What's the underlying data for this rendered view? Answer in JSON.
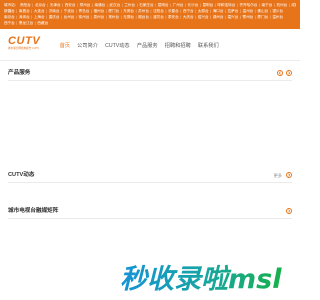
{
  "topbar": {
    "prefix": "城市站：",
    "lines": [
      [
        "贵阳台",
        "北京台",
        "天津台",
        "西安台",
        "郑州台",
        "南通台",
        "武汉台",
        "兰州台",
        "石家庄台",
        "昆明台",
        "广州台",
        "长沙台",
        "昆明台",
        "呼和浩特台",
        "齐齐哈尔台",
        "南宁台",
        "杭州台",
        "成都台",
        "合肥台"
      ],
      [
        "新疆台",
        "南昌台",
        "大连台",
        "济南台",
        "宁波台",
        "青岛台",
        "福州台",
        "厦门台",
        "东莞台",
        "苏州台",
        "沈阳台",
        "长春台",
        "西宁台",
        "太原台",
        "海口台",
        "拉萨台",
        "温州台",
        "佛山台",
        "银川台"
      ],
      [
        "南京台",
        "深圳台",
        "上海台",
        "重庆台",
        "台州台",
        "徐州台",
        "泉州台",
        "常州台",
        "无锡台",
        "烟台台",
        "潍坊台",
        "泰安台",
        "大庆台",
        "绍兴台",
        "湖州台",
        "嘉兴台",
        "鄂州台",
        "厦门台",
        "温州台"
      ],
      [
        "西宁台",
        "黑龙江台",
        "西藏台"
      ]
    ]
  },
  "header": {
    "logo_text": "CUTV",
    "logo_subtext": "城市联合网络电视台 CUTV",
    "nav": [
      {
        "label": "首页",
        "active": true
      },
      {
        "label": "公司简介",
        "active": false
      },
      {
        "label": "CUTV动态",
        "active": false
      },
      {
        "label": "产品服务",
        "active": false
      },
      {
        "label": "招聘和招聘",
        "active": false
      },
      {
        "label": "联系我们",
        "active": false
      }
    ]
  },
  "sections": {
    "products": {
      "title": "产品服务",
      "more": ""
    },
    "news": {
      "title": "CUTV动态",
      "more": "更多"
    },
    "matrix": {
      "title": "城市电视台融媒矩阵",
      "more": ""
    }
  },
  "watermark": {
    "text": "秒收录啦msl"
  },
  "colors": {
    "accent": "#e8741a",
    "watermark_blue": "#1592d6",
    "watermark_green": "#18b14a"
  }
}
